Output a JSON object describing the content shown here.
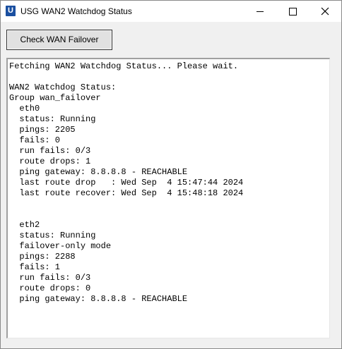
{
  "window": {
    "title": "USG WAN2 Watchdog Status",
    "app_icon_glyph": "U",
    "app_icon_color": "#1a4fa0",
    "controls": {
      "minimize": "minimize-icon",
      "maximize": "maximize-icon",
      "close": "close-icon"
    }
  },
  "toolbar": {
    "check_button_label": "Check WAN Failover"
  },
  "output": {
    "lines": [
      "Fetching WAN2 Watchdog Status... Please wait.",
      "",
      "WAN2 Watchdog Status:",
      "Group wan_failover",
      "  eth0",
      "  status: Running",
      "  pings: 2205",
      "  fails: 0",
      "  run fails: 0/3",
      "  route drops: 1",
      "  ping gateway: 8.8.8.8 - REACHABLE",
      "  last route drop   : Wed Sep  4 15:47:44 2024",
      "  last route recover: Wed Sep  4 15:48:18 2024",
      "",
      "",
      "  eth2",
      "  status: Running",
      "  failover-only mode",
      "  pings: 2288",
      "  fails: 1",
      "  run fails: 0/3",
      "  route drops: 0",
      "  ping gateway: 8.8.8.8 - REACHABLE"
    ]
  }
}
